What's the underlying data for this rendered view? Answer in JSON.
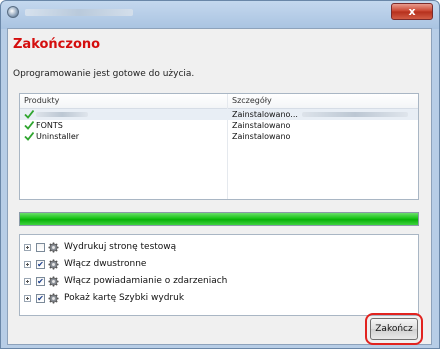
{
  "window": {
    "title": "",
    "close_glyph": "x"
  },
  "main": {
    "heading": "Zakończono",
    "subtitle": "Oprogramowanie jest gotowe do użycia."
  },
  "products_list": {
    "columns": [
      "Produkty",
      "Szczegóły"
    ],
    "rows": [
      {
        "name": "",
        "status": "Zainstalowano...",
        "icon": "check-icon"
      },
      {
        "name": "FONTS",
        "status": "Zainstalowano",
        "icon": "check-icon"
      },
      {
        "name": "Uninstaller",
        "status": "Zainstalowano",
        "icon": "check-icon"
      }
    ]
  },
  "progress": {
    "percent": 100,
    "color": "#17c317"
  },
  "options": {
    "items": [
      {
        "label": "Wydrukuj stronę testową",
        "checked": false,
        "icon": "gear-icon"
      },
      {
        "label": "Włącz dwustronne",
        "checked": true,
        "icon": "gear-icon"
      },
      {
        "label": "Włącz powiadamianie o zdarzeniach",
        "checked": true,
        "icon": "gear-icon"
      },
      {
        "label": "Pokaż kartę Szybki wydruk",
        "checked": true,
        "icon": "gear-icon"
      }
    ]
  },
  "footer": {
    "finish_label": "Zakończ",
    "highlight_color": "#e1231f"
  },
  "colors": {
    "heading": "#d40e0e",
    "accent": "#17c317"
  }
}
